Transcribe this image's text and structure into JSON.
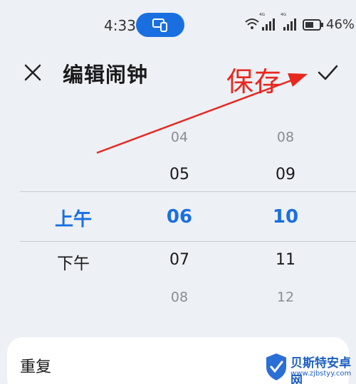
{
  "status_bar": {
    "time": "4:33",
    "signal_1": "⁴ᴳ",
    "signal_2": "⁴ᴳ",
    "battery_pct": "46%"
  },
  "header": {
    "title": "编辑闹钟"
  },
  "annotation": {
    "label": "保存",
    "color": "#e8271f"
  },
  "picker": {
    "ampm": {
      "options": [
        "上午",
        "下午"
      ],
      "selected": "上午"
    },
    "hours": {
      "visible": [
        "04",
        "05",
        "06",
        "07",
        "08"
      ],
      "selected": "06"
    },
    "minutes": {
      "visible": [
        "08",
        "09",
        "10",
        "11",
        "12"
      ],
      "selected": "10"
    }
  },
  "settings": {
    "repeat_label": "重复"
  },
  "watermark": {
    "name": "贝斯特安卓网",
    "url": "www.zjbstyy.com"
  },
  "colors": {
    "accent": "#1a6fe0",
    "background": "#edf0f5"
  }
}
